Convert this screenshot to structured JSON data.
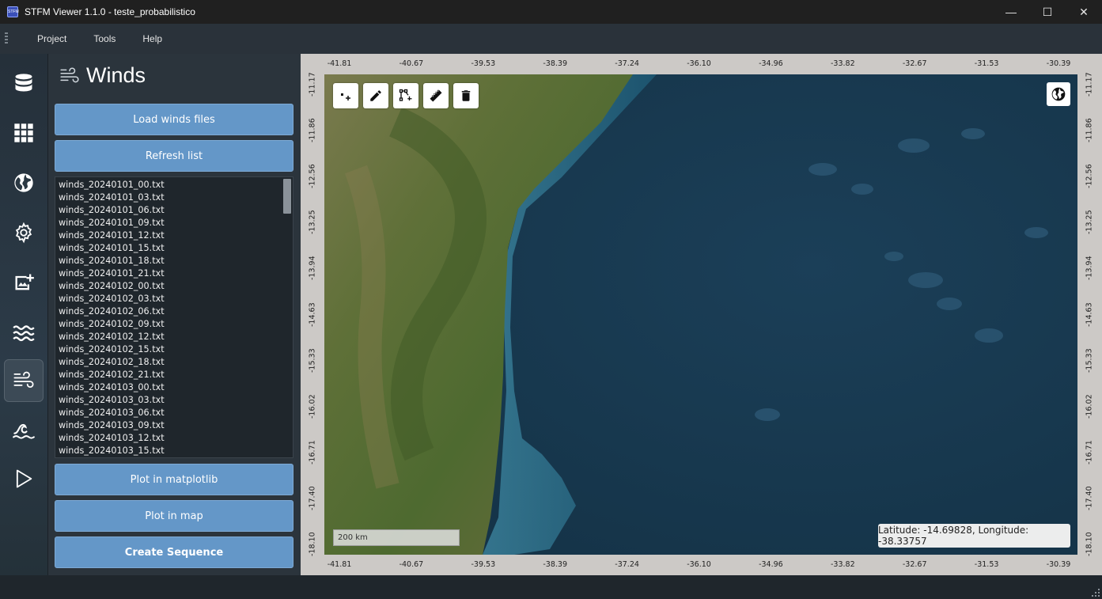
{
  "window": {
    "title": "STFM Viewer 1.1.0 - teste_probabilistico",
    "app_icon_text": "STFM",
    "minimize": "—",
    "maximize": "☐",
    "close": "✕"
  },
  "menu": {
    "items": [
      "Project",
      "Tools",
      "Help"
    ]
  },
  "sidebar": {
    "items": [
      {
        "icon": "database-icon",
        "active": false
      },
      {
        "icon": "grid-icon",
        "active": false
      },
      {
        "icon": "globe-icon",
        "active": false
      },
      {
        "icon": "gear-icon",
        "active": false
      },
      {
        "icon": "add-image-icon",
        "active": false
      },
      {
        "icon": "waves-icon",
        "active": false
      },
      {
        "icon": "wind-icon",
        "active": true
      },
      {
        "icon": "ocean-wave-icon",
        "active": false
      },
      {
        "icon": "play-icon",
        "active": false
      }
    ]
  },
  "panel": {
    "title": "Winds",
    "load_button": "Load winds files",
    "refresh_button": "Refresh list",
    "files": [
      "winds_20240101_00.txt",
      "winds_20240101_03.txt",
      "winds_20240101_06.txt",
      "winds_20240101_09.txt",
      "winds_20240101_12.txt",
      "winds_20240101_15.txt",
      "winds_20240101_18.txt",
      "winds_20240101_21.txt",
      "winds_20240102_00.txt",
      "winds_20240102_03.txt",
      "winds_20240102_06.txt",
      "winds_20240102_09.txt",
      "winds_20240102_12.txt",
      "winds_20240102_15.txt",
      "winds_20240102_18.txt",
      "winds_20240102_21.txt",
      "winds_20240103_00.txt",
      "winds_20240103_03.txt",
      "winds_20240103_06.txt",
      "winds_20240103_09.txt",
      "winds_20240103_12.txt",
      "winds_20240103_15.txt"
    ],
    "plot_matplotlib_button": "Plot in matplotlib",
    "plot_map_button": "Plot in map",
    "create_sequence_button": "Create Sequence"
  },
  "map": {
    "x_ticks": [
      "-41.81",
      "-40.67",
      "-39.53",
      "-38.39",
      "-37.24",
      "-36.10",
      "-34.96",
      "-33.82",
      "-32.67",
      "-31.53",
      "-30.39"
    ],
    "y_ticks": [
      "-11.17",
      "-11.86",
      "-12.56",
      "-13.25",
      "-13.94",
      "-14.63",
      "-15.33",
      "-16.02",
      "-16.71",
      "-17.40",
      "-18.10"
    ],
    "tools": [
      "add-point-icon",
      "pencil-icon",
      "polyline-icon",
      "ruler-icon",
      "trash-icon"
    ],
    "scale_label": "200 km",
    "coordinates": "Latitude: -14.69828, Longitude: -38.33757"
  }
}
